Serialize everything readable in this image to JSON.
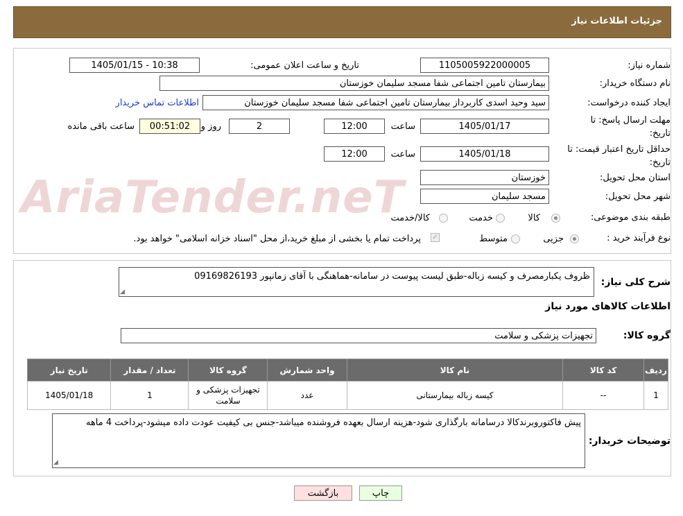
{
  "header": {
    "title": "جزئیات اطلاعات نیاز"
  },
  "watermark": "AriaTender.neT",
  "form": {
    "need_number_label": "شماره نیاز:",
    "need_number": "1105005922000005",
    "announce_label": "تاریخ و ساعت اعلان عمومی:",
    "announce_value": "1405/01/15 - 10:38",
    "buyer_org_label": "نام دستگاه خریدار:",
    "buyer_org": "بیمارستان تامین اجتماعی شفا مسجد سلیمان خوزستان",
    "creator_label": "ایجاد کننده درخواست:",
    "creator": "سید وحید اسدی کاربرداز بیمارستان تامین اجتماعی شفا مسجد سلیمان خوزستان",
    "contact_link": "اطلاعات تماس خریدار",
    "deadline_label": "مهلت ارسال پاسخ: تا تاریخ:",
    "deadline_date": "1405/01/17",
    "time_label": "ساعت",
    "deadline_time": "12:00",
    "days_value": "2",
    "days_label": "روز و",
    "remaining_value": "00:51:02",
    "remaining_label": "ساعت باقی مانده",
    "validity_label": "حداقل تاریخ اعتبار قیمت: تا تاریخ:",
    "validity_date": "1405/01/18",
    "validity_time": "12:00",
    "province_label": "استان محل تحویل:",
    "province": "خوزستان",
    "city_label": "شهر محل تحویل:",
    "city": "مسجد سلیمان",
    "category_label": "طبقه بندی موضوعی:",
    "category_options": [
      "کالا",
      "خدمت",
      "کالا/خدمت"
    ],
    "process_label": "نوع فرآیند خرید :",
    "process_options": [
      "جزیی",
      "متوسط"
    ],
    "payment_note": "پرداخت تمام یا بخشی از مبلغ خرید،از محل \"اسناد خزانه اسلامی\" خواهد بود."
  },
  "summary": {
    "description_label": "شرح کلی نیاز:",
    "description": "ظروف یکبارمصرف و کیسه زباله-طبق لیست پیوست در سامانه-هماهنگی با آقای زمانپور 09169826193",
    "goods_info_title": "اطلاعات کالاهای مورد نیاز",
    "group_label": "گروه کالا:",
    "group_value": "تجهیزات پزشکی و سلامت",
    "table": {
      "headers": [
        "ردیف",
        "کد کالا",
        "نام کالا",
        "واحد شمارش",
        "گروه کالا",
        "تعداد / مقدار",
        "تاریخ نیاز"
      ],
      "rows": [
        [
          "1",
          "--",
          "کیسه زباله بیمارستانی",
          "عدد",
          "تجهیزات پزشکی و سلامت",
          "1",
          "1405/01/18"
        ]
      ]
    },
    "buyer_notes_label": "توضیحات خریدار:",
    "buyer_notes": "پیش فاکتوروبرندکالا درسامانه بارگذاری شود-هزینه ارسال بعهده فروشنده میباشد-جنس بی کیفیت عودت داده میشود-پرداخت 4 ماهه"
  },
  "buttons": {
    "print": "چاپ",
    "back": "بازگشت"
  },
  "colors": {
    "header_bg": "#8b6b3d",
    "table_header_bg": "#6b6b6b",
    "back_button_bg": "#ffe0e0",
    "print_button_bg": "#e8ffe0",
    "remaining_bg": "#ffffe0",
    "link": "#1a3dcc"
  }
}
